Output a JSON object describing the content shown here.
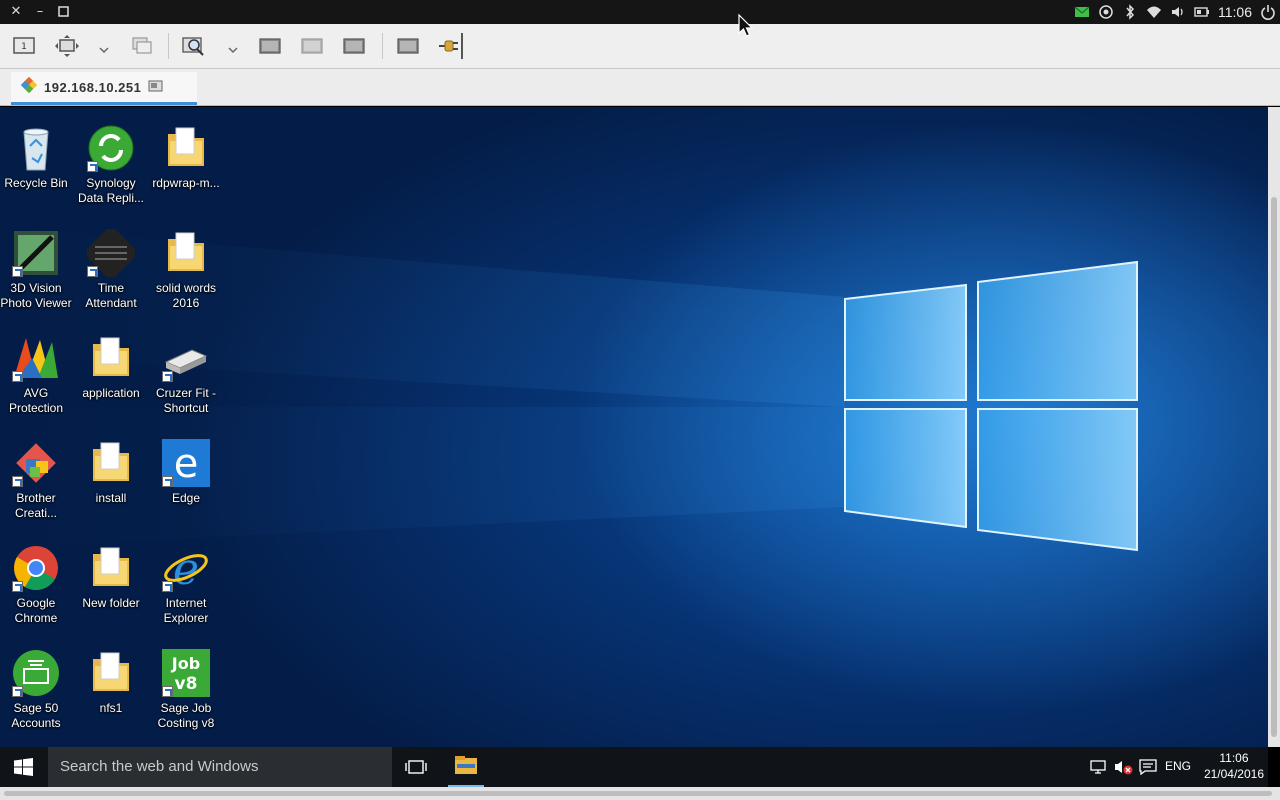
{
  "system_bar": {
    "time": "11:06",
    "icons": [
      "close-icon",
      "minimize-icon",
      "maximize-icon",
      "mail-icon",
      "location-icon",
      "bluetooth-icon",
      "wifi-icon",
      "volume-icon",
      "battery-icon",
      "power-icon"
    ]
  },
  "toolbar": {
    "icons": [
      "display-icon",
      "fit-screen-icon",
      "chevron-down-icon",
      "multi-window-icon",
      "zoom-icon",
      "chevron-down-icon",
      "screenshot-icon",
      "screen-icon",
      "screen-icon",
      "screen-icon",
      "disconnect-icon"
    ]
  },
  "tab": {
    "label": "192.168.10.251"
  },
  "desktop": {
    "icons": [
      {
        "label": "Recycle Bin",
        "icon": "recycle-bin-icon"
      },
      {
        "label": "Synology Data Repli...",
        "icon": "synology-icon"
      },
      {
        "label": "rdpwrap-m...",
        "icon": "folder-icon"
      },
      {
        "label": "3D Vision Photo Viewer",
        "icon": "photo-viewer-icon"
      },
      {
        "label": "Time Attendant",
        "icon": "time-attendant-icon"
      },
      {
        "label": "solid words 2016",
        "icon": "folder-icon"
      },
      {
        "label": "AVG Protection",
        "icon": "avg-icon"
      },
      {
        "label": "application",
        "icon": "folder-icon"
      },
      {
        "label": "Cruzer Fit - Shortcut",
        "icon": "usb-drive-icon"
      },
      {
        "label": "Brother Creati...",
        "icon": "brother-icon"
      },
      {
        "label": "install",
        "icon": "folder-icon"
      },
      {
        "label": "Edge",
        "icon": "edge-icon"
      },
      {
        "label": "Google Chrome",
        "icon": "chrome-icon"
      },
      {
        "label": "New folder",
        "icon": "folder-icon"
      },
      {
        "label": "Internet Explorer",
        "icon": "ie-icon"
      },
      {
        "label": "Sage 50 Accounts",
        "icon": "sage-icon"
      },
      {
        "label": "nfs1",
        "icon": "folder-icon"
      },
      {
        "label": "Sage Job Costing v8",
        "icon": "sage-job-icon"
      }
    ]
  },
  "taskbar": {
    "search_placeholder": "Search the web and Windows",
    "language": "ENG",
    "time": "11:06",
    "date": "21/04/2016"
  },
  "colors": {
    "accent": "#3d8fd6",
    "desktop_bg": "#06306e",
    "taskbar_bg": "#101418"
  }
}
